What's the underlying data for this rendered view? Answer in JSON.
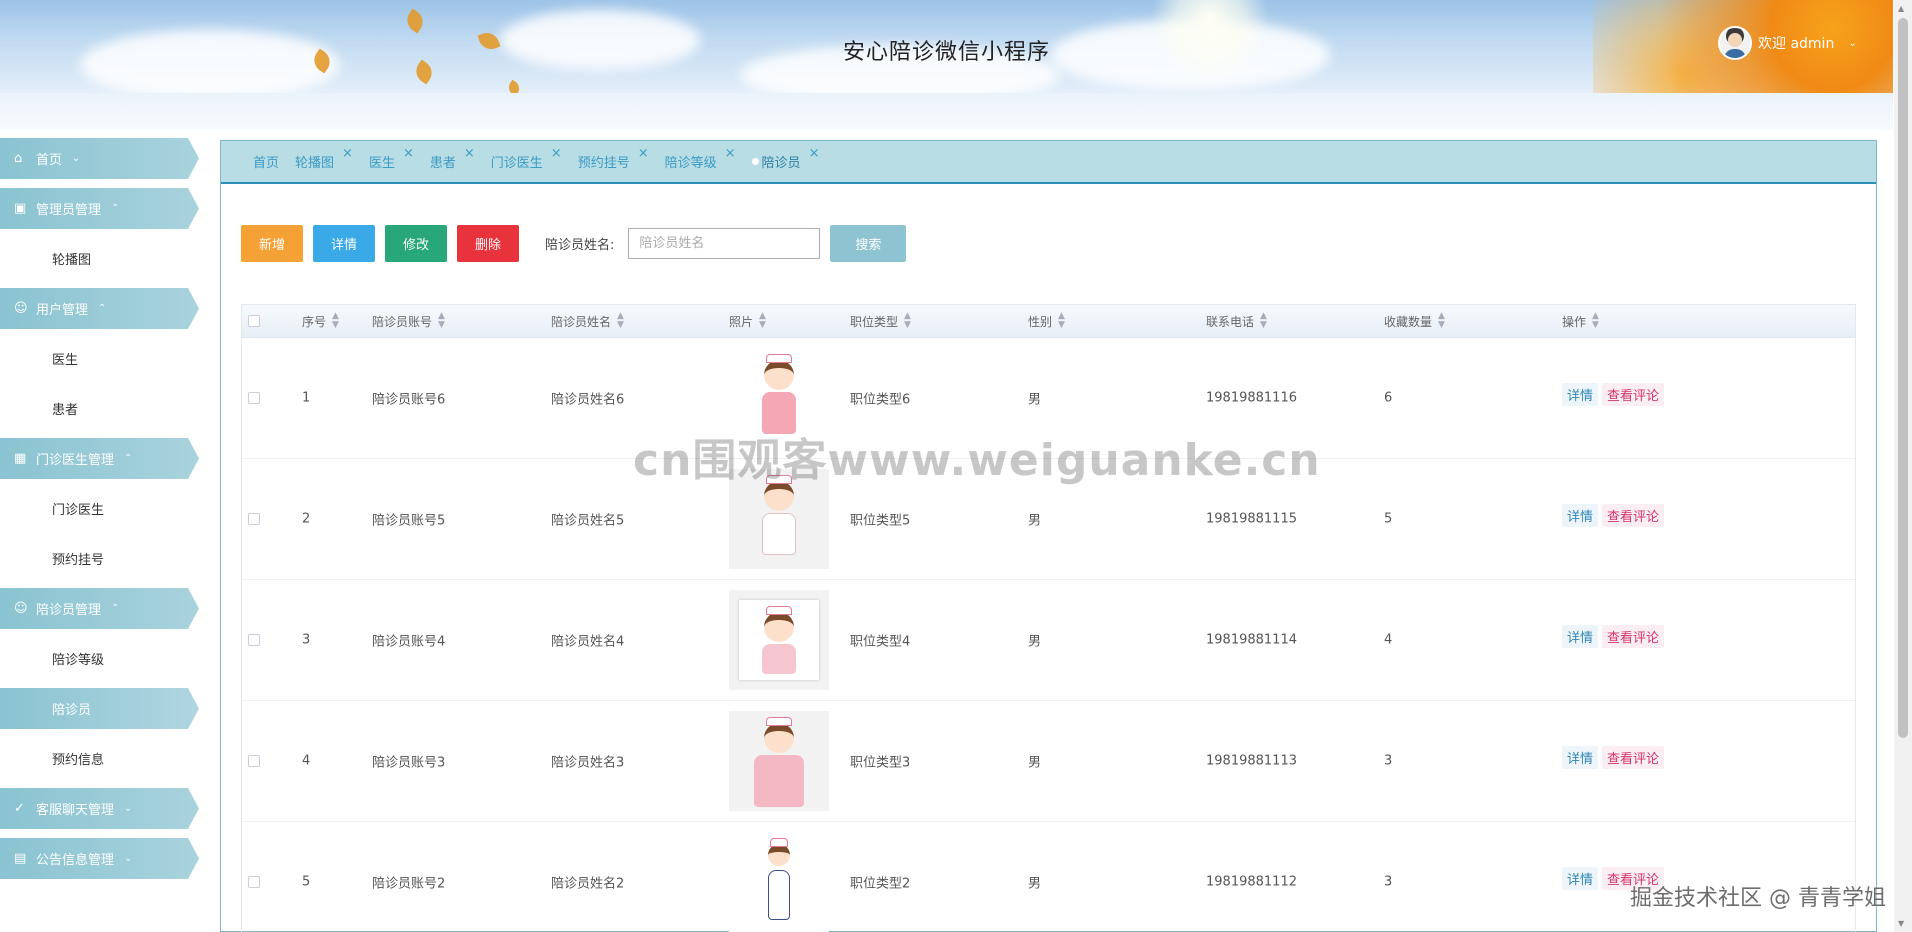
{
  "header": {
    "title": "安心陪诊微信小程序",
    "welcome": "欢迎 admin"
  },
  "sidebar": {
    "groups": [
      {
        "label": "首页",
        "icon": "home-icon",
        "items": []
      },
      {
        "label": "管理员管理",
        "icon": "admin-icon",
        "items": [
          {
            "label": "轮播图"
          }
        ]
      },
      {
        "label": "用户管理",
        "icon": "user-icon",
        "items": [
          {
            "label": "医生"
          },
          {
            "label": "患者"
          }
        ]
      },
      {
        "label": "门诊医生管理",
        "icon": "building-icon",
        "items": [
          {
            "label": "门诊医生"
          },
          {
            "label": "预约挂号"
          }
        ]
      },
      {
        "label": "陪诊员管理",
        "icon": "user-icon",
        "items": [
          {
            "label": "陪诊等级"
          },
          {
            "label": "陪诊员"
          },
          {
            "label": "预约信息"
          }
        ]
      },
      {
        "label": "客服聊天管理",
        "icon": "chat-icon",
        "items": []
      },
      {
        "label": "公告信息管理",
        "icon": "notice-icon",
        "items": []
      }
    ],
    "active_item": "陪诊员"
  },
  "tabs": [
    {
      "label": "首页"
    },
    {
      "label": "轮播图"
    },
    {
      "label": "医生"
    },
    {
      "label": "患者"
    },
    {
      "label": "门诊医生"
    },
    {
      "label": "预约挂号"
    },
    {
      "label": "陪诊等级"
    },
    {
      "label": "陪诊员"
    }
  ],
  "toolbar": {
    "add": "新增",
    "detail": "详情",
    "edit": "修改",
    "delete": "删除",
    "search_label": "陪诊员姓名:",
    "search_placeholder": "陪诊员姓名",
    "search_value": "",
    "search_button": "搜索"
  },
  "table": {
    "columns": [
      "序号",
      "陪诊员账号",
      "陪诊员姓名",
      "照片",
      "职位类型",
      "性别",
      "联系电话",
      "收藏数量",
      "操作"
    ],
    "rows": [
      {
        "no": "1",
        "account": "陪诊员账号6",
        "name": "陪诊员姓名6",
        "type": "职位类型6",
        "gender": "男",
        "phone": "19819881116",
        "fav": "6"
      },
      {
        "no": "2",
        "account": "陪诊员账号5",
        "name": "陪诊员姓名5",
        "type": "职位类型5",
        "gender": "男",
        "phone": "19819881115",
        "fav": "5"
      },
      {
        "no": "3",
        "account": "陪诊员账号4",
        "name": "陪诊员姓名4",
        "type": "职位类型4",
        "gender": "男",
        "phone": "19819881114",
        "fav": "4"
      },
      {
        "no": "4",
        "account": "陪诊员账号3",
        "name": "陪诊员姓名3",
        "type": "职位类型3",
        "gender": "男",
        "phone": "19819881113",
        "fav": "3"
      },
      {
        "no": "5",
        "account": "陪诊员账号2",
        "name": "陪诊员姓名2",
        "type": "职位类型2",
        "gender": "男",
        "phone": "19819881112",
        "fav": "3"
      }
    ],
    "op_detail": "详情",
    "op_comment": "查看评论"
  },
  "watermark": "cn围观客www.weiguanke.cn",
  "corner_watermark": "掘金技术社区 @ 青青学姐",
  "colors": {
    "accent": "#8ac3d1",
    "tab_active": "#2b8fb6",
    "add": "#f4a136",
    "detail": "#3aa9e8",
    "edit": "#27a77a",
    "delete": "#e8323c"
  }
}
